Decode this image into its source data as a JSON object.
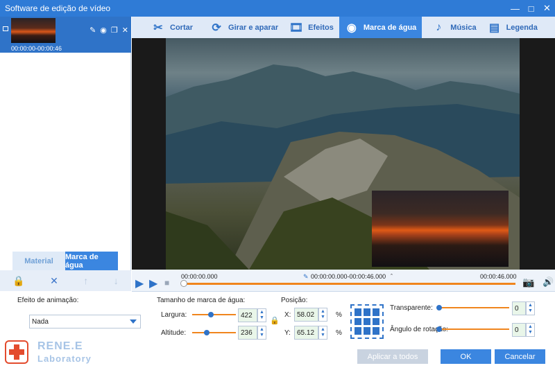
{
  "window": {
    "title": "Software de edição de vídeo"
  },
  "clip": {
    "time_range": "00:00:00-00:00:46"
  },
  "left_tabs": [
    {
      "label": "Material"
    },
    {
      "label": "Marca de água"
    }
  ],
  "toolbar": {
    "items": [
      {
        "label": "Cortar",
        "icon": "scissors-icon"
      },
      {
        "label": "Girar e aparar",
        "icon": "rotate-crop-icon"
      },
      {
        "label": "Efeitos",
        "icon": "effects-icon"
      },
      {
        "label": "Marca de água",
        "icon": "watermark-icon"
      },
      {
        "label": "Música",
        "icon": "music-icon"
      },
      {
        "label": "Legenda",
        "icon": "subtitle-icon"
      }
    ],
    "active_index": 3
  },
  "timeline": {
    "start": "00:00:00.000",
    "range": "00:00:00.000-00:00:46.000",
    "end": "00:00:46.000",
    "progress": 0.0
  },
  "bottom": {
    "animation_label": "Efeito de animação:",
    "animation_value": "Nada",
    "size_label": "Tamanho de marca de água:",
    "width_label": "Largura:",
    "width_value": "422",
    "height_label": "Altitude:",
    "height_value": "236",
    "position_label": "Posição:",
    "x_label": "X:",
    "x_value": "58.02",
    "y_label": "Y:",
    "y_value": "65.12",
    "percent": "%",
    "transparency_label": "Transparente:",
    "transparency_value": "0",
    "rotation_label": "Ângulo de rotação:",
    "rotation_value": "0",
    "apply_all": "Aplicar a todos",
    "ok": "OK",
    "cancel": "Cancelar"
  },
  "logo": {
    "name": "RENE.E",
    "sub": "Laboratory"
  },
  "colors": {
    "accent": "#3b86e0",
    "slider": "#f0851d",
    "titlebar": "#2f7bd6"
  }
}
